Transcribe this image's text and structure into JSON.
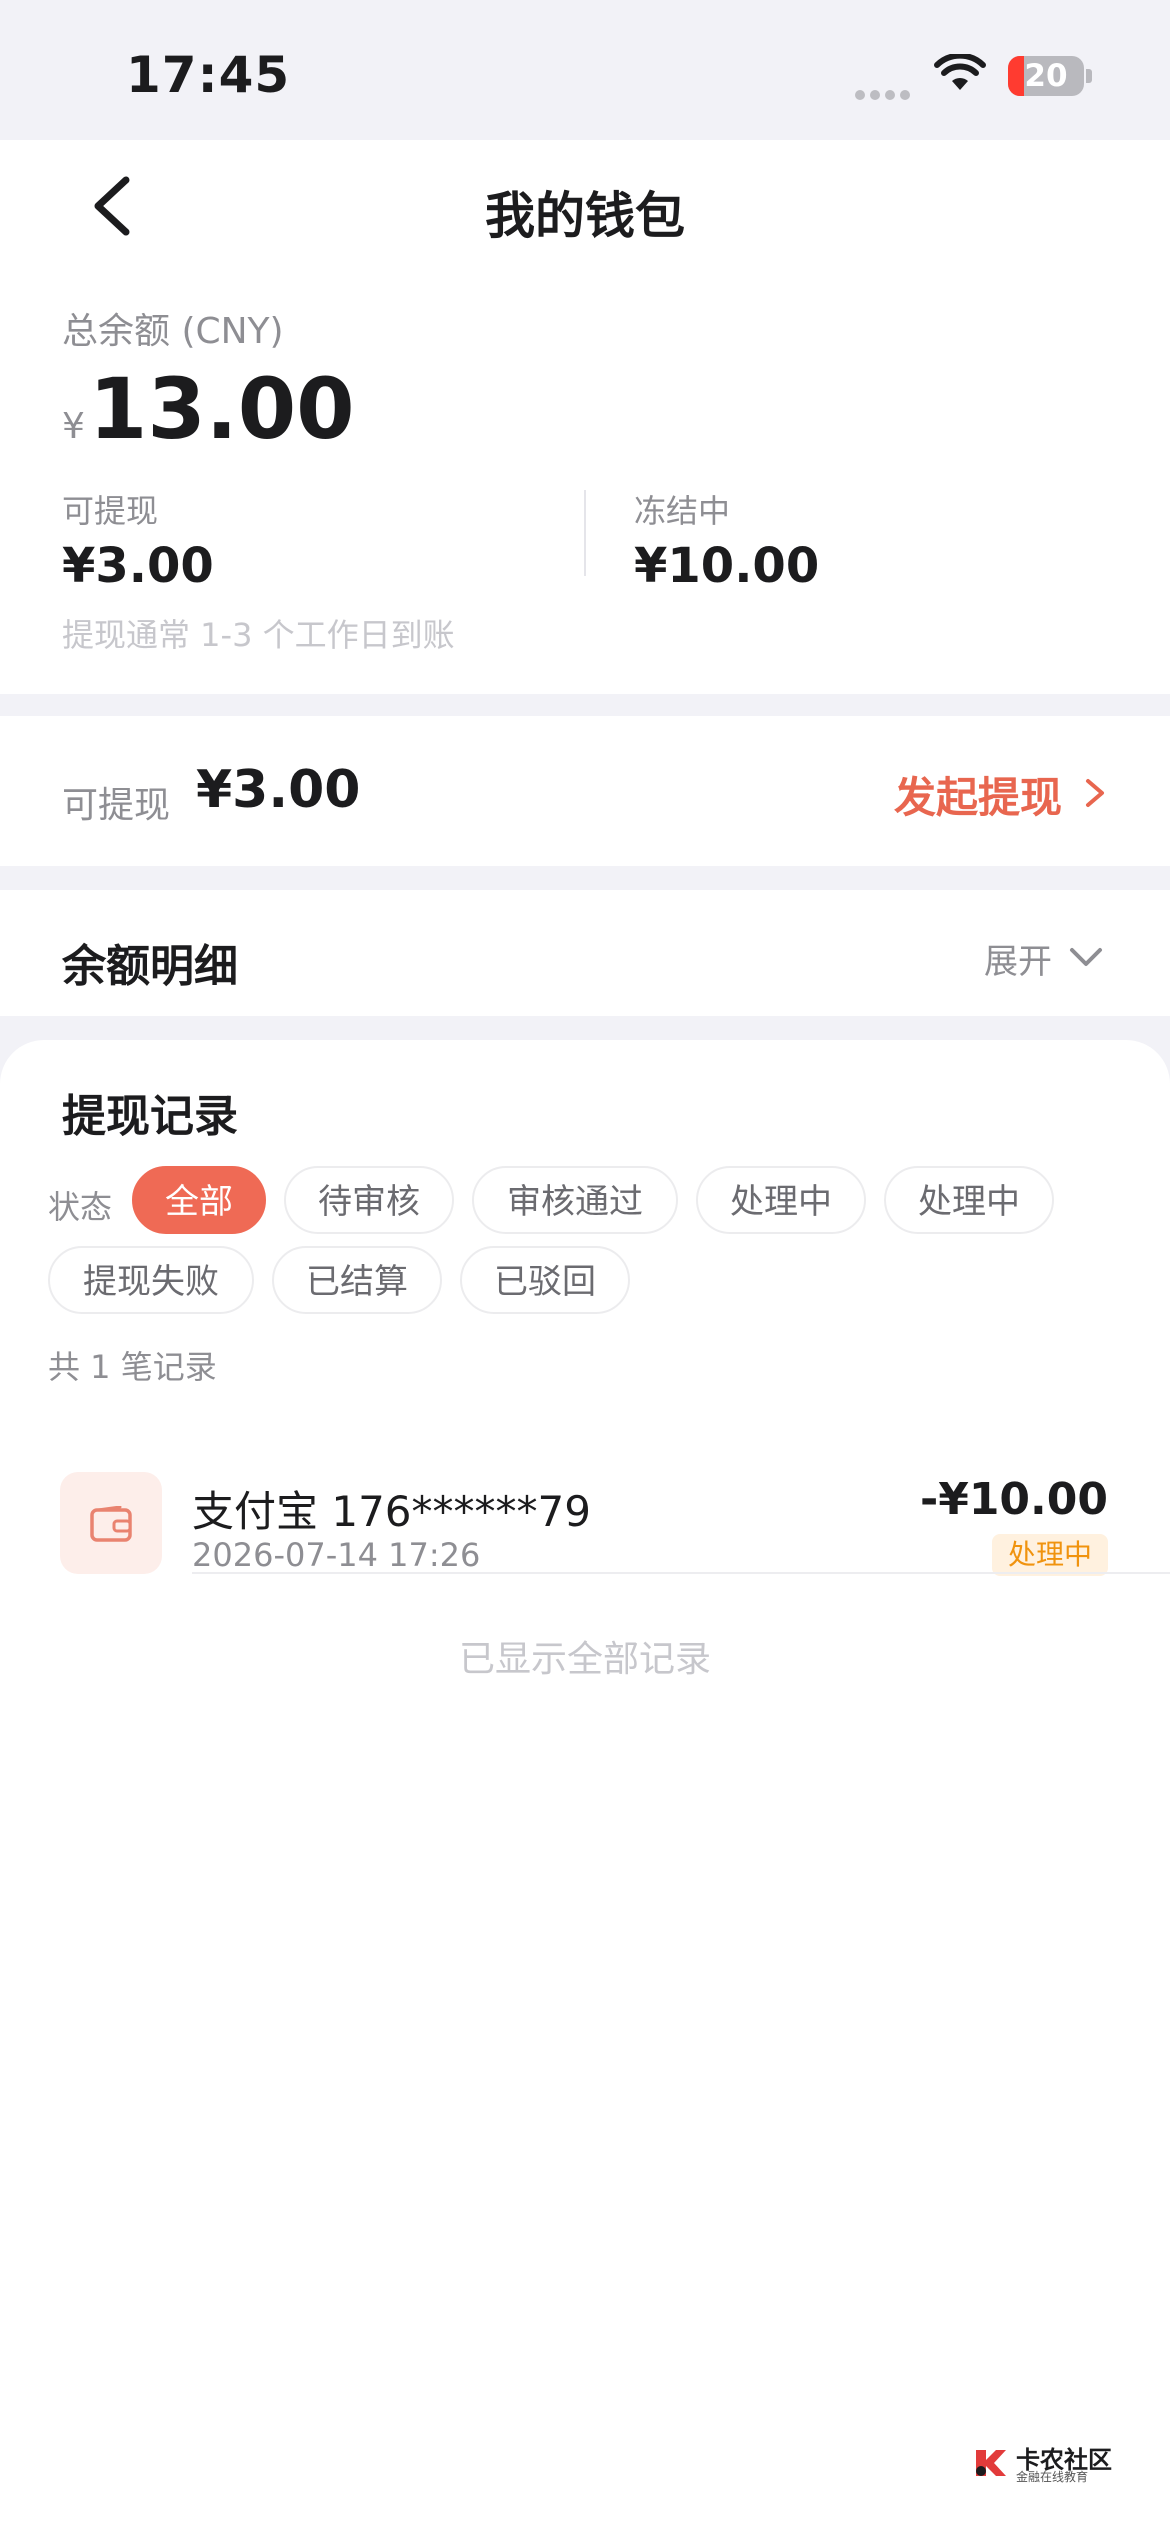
{
  "status_bar": {
    "time": "17:45",
    "battery": "20"
  },
  "nav": {
    "title": "我的钱包"
  },
  "balance": {
    "total_label": "总余额 (CNY)",
    "currency_symbol": "¥",
    "total_amount": "13.00",
    "available_label": "可提现",
    "available_value": "¥3.00",
    "frozen_label": "冻结中",
    "frozen_value": "¥10.00",
    "hint": "提现通常 1-3 个工作日到账"
  },
  "withdraw": {
    "label": "可提现",
    "amount": "¥3.00",
    "action": "发起提现"
  },
  "details": {
    "title": "余额明细",
    "expand": "展开"
  },
  "records": {
    "title": "提现记录",
    "status_label": "状态",
    "filters": [
      "全部",
      "待审核",
      "审核通过",
      "处理中",
      "处理中",
      "提现失败",
      "已结算",
      "已驳回"
    ],
    "active_filter": "全部",
    "count_text": "共 1 笔记录",
    "items": [
      {
        "name": "支付宝 176******79",
        "time": "2026-07-14 17:26",
        "amount": "-¥10.00",
        "status": "处理中"
      }
    ],
    "end_text": "已显示全部记录"
  },
  "colors": {
    "accent": "#ef6a55",
    "action_text": "#e8664f",
    "badge_text": "#f0930e",
    "badge_bg": "#fff1df"
  },
  "watermark": {
    "title": "卡农社区",
    "subtitle": "金融在线教育"
  }
}
